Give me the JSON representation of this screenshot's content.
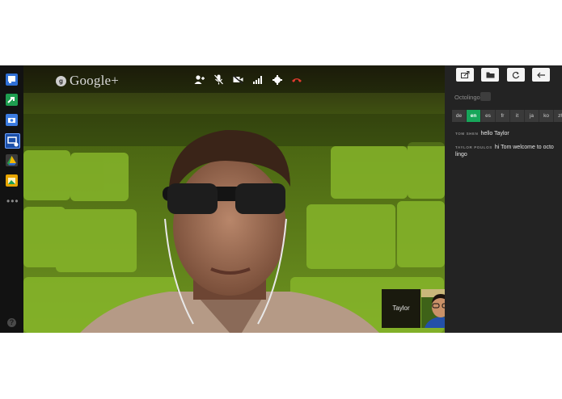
{
  "brand": {
    "name": "Google+",
    "icon": "g"
  },
  "rail": {
    "items": [
      {
        "name": "chat-icon",
        "color": "#3c7be0"
      },
      {
        "name": "screenshare-icon",
        "color": "#1e9e50"
      },
      {
        "name": "camera-icon",
        "color": "#3c7be0"
      },
      {
        "name": "remote-desktop-icon",
        "color": "#3c7be0",
        "active": true
      },
      {
        "name": "drive-icon",
        "color": "#f2b600"
      },
      {
        "name": "effects-icon",
        "color": "#e8a500"
      }
    ],
    "more": "•••",
    "help": "?"
  },
  "controls": [
    "invite-icon",
    "mic-mute-icon",
    "video-off-icon",
    "signal-icon",
    "settings-icon",
    "hangup-icon"
  ],
  "preview": {
    "name": "Taylor"
  },
  "panel": {
    "tools": [
      "share-icon",
      "folder-icon",
      "refresh-icon",
      "back-icon"
    ],
    "app_title": "Octolingo",
    "languages": [
      "de",
      "en",
      "es",
      "fr",
      "it",
      "ja",
      "ko",
      "zh"
    ],
    "active_language": "en",
    "messages": [
      {
        "author": "TOM SHEN",
        "text": "hello Taylor"
      },
      {
        "author": "TAYLOR POULOS",
        "text": "hi Tom welcome to octo lingo"
      }
    ]
  },
  "colors": {
    "accent_green": "#17a65a",
    "hangup_red": "#e03a2e"
  }
}
